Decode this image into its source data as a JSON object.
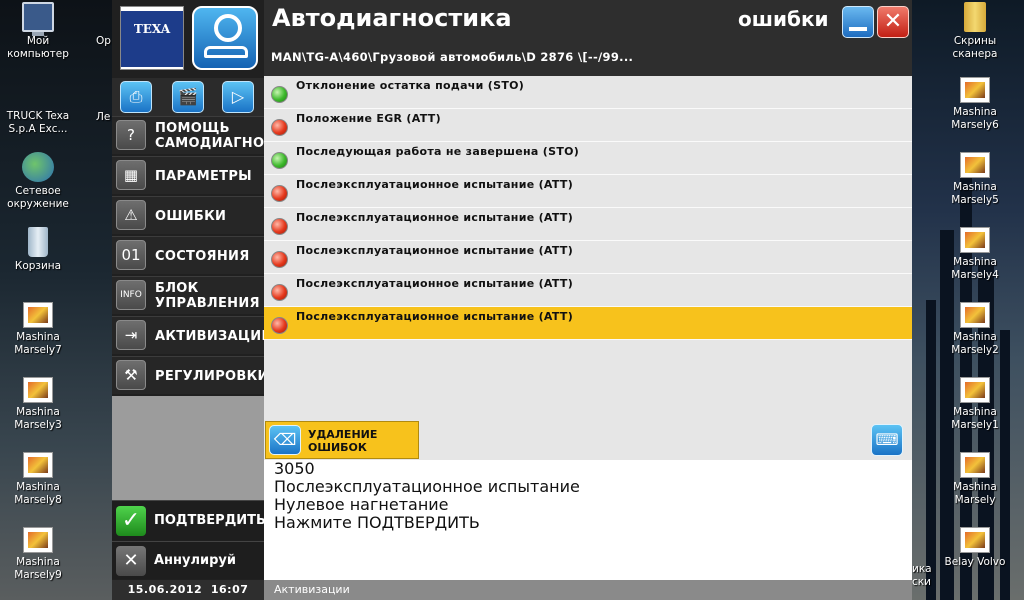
{
  "desktop": {
    "left_icons": [
      {
        "label": "Мой компьютер",
        "icon": "computer-icon"
      },
      {
        "label": "TRUCK Texa S.p.A Exc...",
        "icon": "app-icon"
      },
      {
        "label": "Сетевое окружение",
        "icon": "network-icon"
      },
      {
        "label": "Корзина",
        "icon": "recycle-bin-icon"
      },
      {
        "label": "Mashina Marsely7",
        "icon": "image-file-icon"
      },
      {
        "label": "Mashina Marsely3",
        "icon": "image-file-icon"
      },
      {
        "label": "Mashina Marsely8",
        "icon": "image-file-icon"
      },
      {
        "label": "Mashina Marsely9",
        "icon": "image-file-icon"
      }
    ],
    "left_partial": [
      "Op",
      "Ле"
    ],
    "right_icons": [
      {
        "label": "Скрины сканера",
        "icon": "folder-icon"
      },
      {
        "label": "Mashina Marsely6",
        "icon": "image-file-icon"
      },
      {
        "label": "Mashina Marsely5",
        "icon": "image-file-icon"
      },
      {
        "label": "Mashina Marsely4",
        "icon": "image-file-icon"
      },
      {
        "label": "Mashina Marsely2",
        "icon": "image-file-icon"
      },
      {
        "label": "Mashina Marsely1",
        "icon": "image-file-icon"
      },
      {
        "label": "Mashina Marsely",
        "icon": "image-file-icon"
      },
      {
        "label": "Belay Volvo",
        "icon": "image-file-icon"
      }
    ],
    "right_partial": "ика\nски"
  },
  "app": {
    "logo_text": "TEXA",
    "title": "Автодиагностика",
    "section": "ошибки",
    "vehicle_path": "MAN\\TG-A\\460\\Грузовой автомобиль\\D 2876 \\[--/99...",
    "toolbar_icons": [
      "printer-icon",
      "clapperboard-icon",
      "play-icon"
    ],
    "menu": [
      {
        "label": "ПОМОЩЬ САМОДИАГНО...",
        "icon": "help-icon"
      },
      {
        "label": "ПАРАМЕТРЫ",
        "icon": "grid-icon"
      },
      {
        "label": "ОШИБКИ",
        "icon": "warning-icon"
      },
      {
        "label": "СОСТОЯНИЯ",
        "icon": "state-icon"
      },
      {
        "label": "БЛОК УПРАВЛЕНИЯ",
        "icon": "info-icon"
      },
      {
        "label": "АКТИВИЗАЦИИ",
        "icon": "activation-icon"
      },
      {
        "label": "РЕГУЛИРОВКИ",
        "icon": "adjust-icon"
      }
    ],
    "confirm_label": "ПОДТВЕРДИТЬ",
    "cancel_label": "Аннулируй",
    "date": "15.06.2012",
    "time": "16:07",
    "errors": [
      {
        "text": "Отклонение остатка подачи (STO)",
        "status": "green"
      },
      {
        "text": "Положение EGR  (ATT)",
        "status": "red"
      },
      {
        "text": "Последующая работа не завершена (STO)",
        "status": "green"
      },
      {
        "text": "Послеэксплуатационное испытание  (ATT)",
        "status": "red"
      },
      {
        "text": "Послеэксплуатационное испытание  (ATT)",
        "status": "red"
      },
      {
        "text": "Послеэксплуатационное испытание  (ATT)",
        "status": "red"
      },
      {
        "text": "Послеэксплуатационное испытание (ATT)",
        "status": "red"
      },
      {
        "text": "Послеэксплуатационное испытание (ATT)",
        "status": "red",
        "selected": true
      }
    ],
    "delete_label_1": "УДАЛЕНИЕ",
    "delete_label_2": "ОШИБОК",
    "detail": {
      "code": "3050",
      "name": "Послеэксплуатационное испытание",
      "description": "Нулевое нагнетание",
      "instruction": "Нажмите ПОДТВЕРДИТЬ"
    },
    "status_bar": "Активизации"
  },
  "colors": {
    "accent_yellow": "#f7c21c",
    "led_green": "#3cb82b",
    "led_red": "#e5381c",
    "header_bg": "#2e2e2e"
  }
}
